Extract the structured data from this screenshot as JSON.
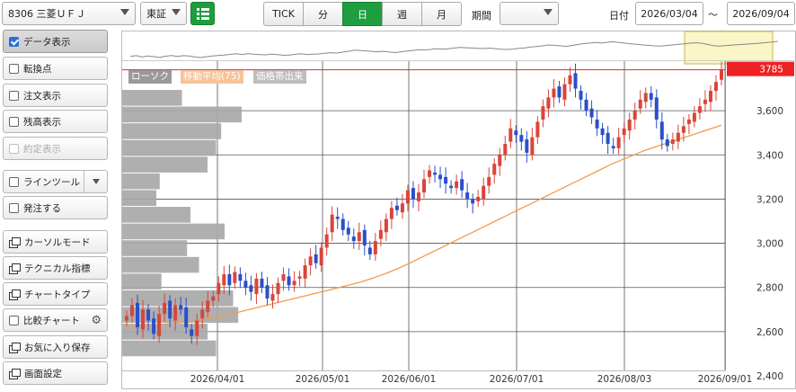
{
  "toolbar": {
    "symbol": "8306 三菱ＵＦＪ",
    "market": "東証",
    "tabs": [
      {
        "label": "TICK",
        "active": false
      },
      {
        "label": "分",
        "active": false
      },
      {
        "label": "日",
        "active": true
      },
      {
        "label": "週",
        "active": false
      },
      {
        "label": "月",
        "active": false
      }
    ],
    "period_label": "期間",
    "period_value": "",
    "date_label": "日付",
    "date_from": "2026/03/04",
    "date_sep": "〜",
    "date_to": "2026/09/04"
  },
  "sidebar": {
    "items": [
      {
        "label": "データ表示",
        "type": "check",
        "checked": true,
        "active": true
      },
      {
        "label": "転換点",
        "type": "check",
        "checked": false
      },
      {
        "label": "注文表示",
        "type": "check",
        "checked": false
      },
      {
        "label": "残高表示",
        "type": "check",
        "checked": false
      },
      {
        "label": "約定表示",
        "type": "check",
        "checked": false,
        "disabled": true
      },
      {
        "label": "ラインツール",
        "type": "check",
        "checked": false
      },
      {
        "label": "発注する",
        "type": "check",
        "checked": false
      },
      {
        "label": "カーソルモード",
        "type": "window"
      },
      {
        "label": "テクニカル指標",
        "type": "window"
      },
      {
        "label": "チャートタイプ",
        "type": "window"
      },
      {
        "label": "比較チャート",
        "type": "check",
        "checked": false
      },
      {
        "label": "お気に入り保存",
        "type": "window"
      },
      {
        "label": "画面設定",
        "type": "window"
      }
    ]
  },
  "legend": {
    "candle": "ローソク",
    "ma": "移動平均(75)",
    "volume_profile": "価格帯出来"
  },
  "colors": {
    "up": "#d9453a",
    "down": "#2a4fc9",
    "ma": "#f39a4a",
    "accent_green": "#1e9e3e",
    "last_price_bg": "#ee2222",
    "volume_bar": "#a8a8a8"
  },
  "chart_data": {
    "type": "candlestick",
    "last_price": "3785",
    "y_ticks": [
      "3,600",
      "3,400",
      "3,200",
      "3,000",
      "2,800",
      "2,600",
      "2,400"
    ],
    "x_ticks": [
      "2026/04/01",
      "2026/05/01",
      "2026/06/01",
      "2026/07/01",
      "2026/08/03",
      "2026/09/01"
    ],
    "ylim": [
      2400,
      3800
    ],
    "close": [
      2670,
      2720,
      2620,
      2700,
      2650,
      2590,
      2680,
      2730,
      2660,
      2720,
      2700,
      2620,
      2580,
      2650,
      2700,
      2740,
      2760,
      2820,
      2860,
      2810,
      2870,
      2830,
      2800,
      2780,
      2840,
      2800,
      2750,
      2770,
      2820,
      2860,
      2810,
      2830,
      2850,
      2900,
      2940,
      2910,
      2980,
      3040,
      3130,
      3110,
      3060,
      3040,
      3010,
      3050,
      2990,
      2950,
      3010,
      3060,
      3110,
      3160,
      3150,
      3180,
      3240,
      3200,
      3230,
      3290,
      3330,
      3310,
      3290,
      3270,
      3250,
      3280,
      3240,
      3200,
      3180,
      3210,
      3260,
      3300,
      3360,
      3400,
      3450,
      3520,
      3490,
      3460,
      3410,
      3480,
      3550,
      3620,
      3660,
      3700,
      3660,
      3720,
      3760,
      3700,
      3650,
      3600,
      3570,
      3520,
      3490,
      3450,
      3430,
      3480,
      3520,
      3560,
      3600,
      3650,
      3680,
      3650,
      3560,
      3470,
      3440,
      3470,
      3500,
      3530,
      3560,
      3590,
      3620,
      3650,
      3690,
      3730,
      3785
    ],
    "ma75": [
      2620,
      2622,
      2624,
      2626,
      2628,
      2630,
      2632,
      2634,
      2636,
      2638,
      2640,
      2643,
      2646,
      2650,
      2654,
      2658,
      2662,
      2666,
      2672,
      2678,
      2684,
      2690,
      2696,
      2702,
      2708,
      2714,
      2720,
      2726,
      2732,
      2738,
      2744,
      2750,
      2756,
      2762,
      2768,
      2774,
      2780,
      2786,
      2792,
      2798,
      2804,
      2810,
      2816,
      2823,
      2830,
      2838,
      2846,
      2855,
      2864,
      2874,
      2884,
      2895,
      2906,
      2918,
      2930,
      2942,
      2954,
      2966,
      2978,
      2990,
      3002,
      3014,
      3026,
      3038,
      3050,
      3062,
      3074,
      3086,
      3098,
      3110,
      3122,
      3134,
      3146,
      3158,
      3170,
      3182,
      3194,
      3206,
      3218,
      3230,
      3242,
      3254,
      3266,
      3278,
      3290,
      3302,
      3314,
      3326,
      3338,
      3350,
      3362,
      3372,
      3382,
      3392,
      3402,
      3412,
      3422,
      3430,
      3438,
      3446,
      3454,
      3462,
      3470,
      3478,
      3486,
      3494,
      3502,
      3510,
      3518,
      3526,
      3535
    ],
    "volume_profile": [
      0.35,
      0.7,
      0.58,
      0.55,
      0.5,
      0.22,
      0.2,
      0.4,
      0.6,
      0.38,
      0.45,
      0.23,
      0.65,
      0.68,
      0.5,
      0.55
    ],
    "overview_line": true
  }
}
